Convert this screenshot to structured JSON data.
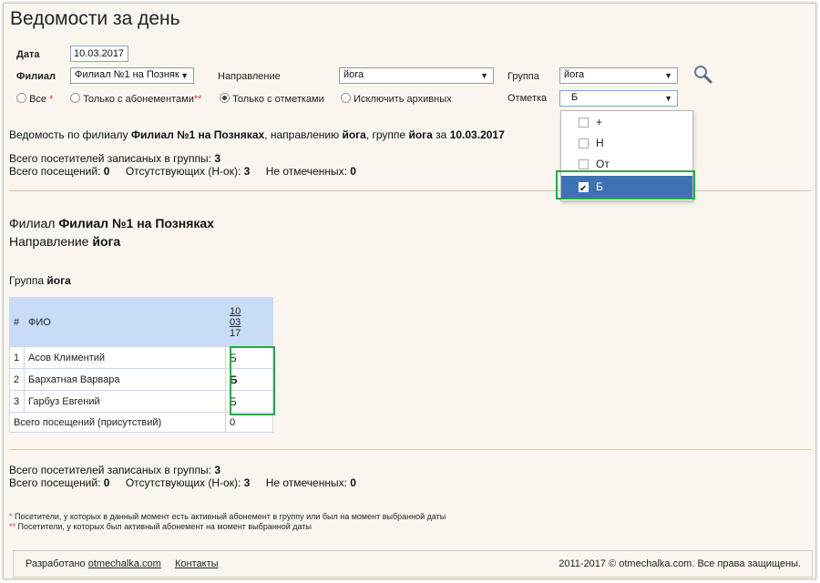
{
  "page_title": "Ведомости за день",
  "filters": {
    "date_label": "Дата",
    "date_value": "10.03.2017",
    "branch_label": "Филиал",
    "branch_value": "Филиал №1 на Позняк",
    "direction_label": "Направление",
    "direction_value": "йога",
    "group_label": "Группа",
    "group_value": "йога",
    "mark_label": "Отметка",
    "mark_value": "Б",
    "radio_all": "Все",
    "radio_all_mark": "*",
    "radio_subs": "Только с абонементами",
    "radio_subs_mark": "**",
    "radio_marks": "Только с отметками",
    "radio_exclude": "Исключить архивных"
  },
  "mark_dropdown": {
    "options": [
      {
        "label": "+",
        "checked": false
      },
      {
        "label": "Н",
        "checked": false
      },
      {
        "label": "От",
        "checked": false
      },
      {
        "label": "Б",
        "checked": true
      }
    ]
  },
  "summary": {
    "intro": "Ведомость по филиалу",
    "branch": "Филиал №1 на Позняках",
    "sep_direction": ", направлению",
    "direction": "йога",
    "sep_group": ", группе",
    "group": "йога",
    "sep_date": "за",
    "date": "10.03.2017",
    "enrolled_label": "Всего посетителей записаных в группы:",
    "enrolled": "3",
    "visits_label": "Всего посещений:",
    "visits": "0",
    "absent_label": "Отсутствующих (Н-ок):",
    "absent": "3",
    "unmarked_label": "Не отмеченных:",
    "unmarked": "0"
  },
  "section": {
    "branch_prefix": "Филиал",
    "branch_name": "Филиал №1 на Позняках",
    "direction_prefix": "Направление",
    "direction_name": "йога",
    "group_prefix": "Группа",
    "group_name": "йога"
  },
  "table": {
    "col_num": "#",
    "col_name": "ФИО",
    "date_day": "10",
    "date_month": "03",
    "date_year": "17",
    "rows": [
      {
        "num": "1",
        "name": "Асов Климентий",
        "mark": "Б"
      },
      {
        "num": "2",
        "name": "Бархатная Варвара",
        "mark": "Б"
      },
      {
        "num": "3",
        "name": "Гарбуз Евгений",
        "mark": "Б"
      }
    ],
    "total_label": "Всего посещений (присутствий)",
    "total_value": "0"
  },
  "footnotes": {
    "note1_mark": "*",
    "note1": "Посетители, у которых в данный момент есть активный абонемент в группу или был на момент выбранной даты",
    "note2_mark": "**",
    "note2": "Посетители, у которых был активный абонемент на момент выбранной даты"
  },
  "footer": {
    "developed_by": "Разработано",
    "site_link": "otmechalka.com",
    "contacts_link": "Контакты",
    "copyright": "2011-2017 © otmechalka.com. Все права защищены."
  },
  "colors": {
    "highlight": "#27a844",
    "mark_blue": "#1f9ad6",
    "selected_option": "#3d73b3",
    "table_header": "#c8dcf8"
  }
}
